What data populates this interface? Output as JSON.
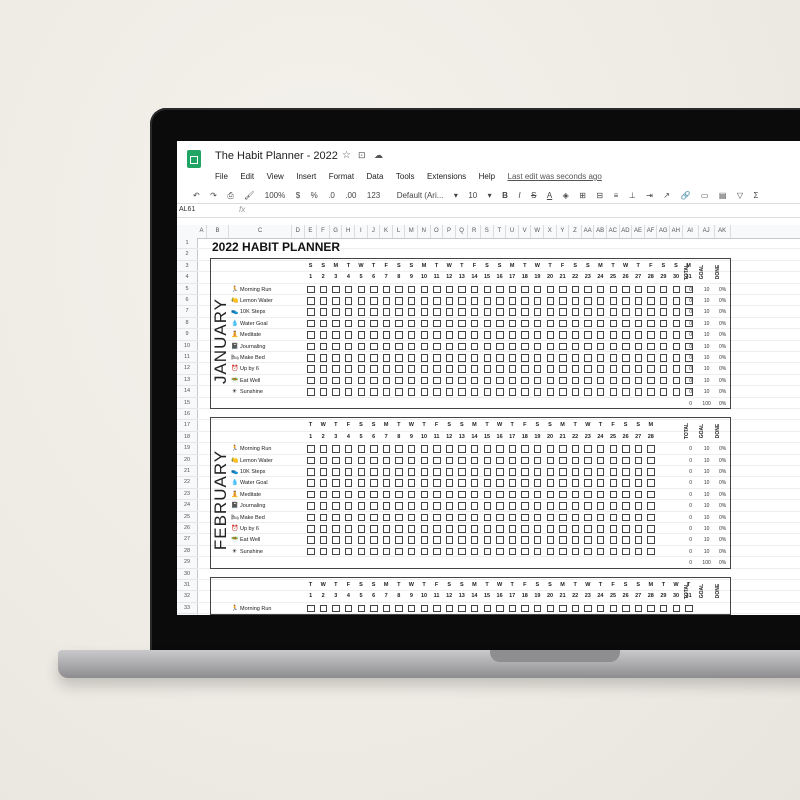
{
  "app": {
    "title": "The Habit Planner - 2022",
    "last_edit": "Last edit was seconds ago",
    "menu": [
      "File",
      "Edit",
      "View",
      "Insert",
      "Format",
      "Data",
      "Tools",
      "Extensions",
      "Help"
    ]
  },
  "toolbar": {
    "zoom": "100%",
    "currency": "$",
    "percent": "%",
    "dec_less": ".0",
    "dec_more": ".00",
    "format": "123",
    "font": "Default (Ari...",
    "font_size": "10",
    "bold": "B",
    "italic": "I",
    "strike": "S",
    "text_color": "A"
  },
  "formula_bar": {
    "cell_ref": "AL61",
    "fx": "fx"
  },
  "sheet": {
    "title": "2022 HABIT PLANNER",
    "col_headers": [
      "A",
      "B",
      "C",
      "D",
      "E",
      "F",
      "G",
      "H",
      "I",
      "J",
      "K",
      "L",
      "M",
      "N",
      "O",
      "P",
      "Q",
      "R",
      "S",
      "T",
      "U",
      "V",
      "W",
      "X",
      "Y",
      "Z",
      "AA",
      "AB",
      "AC",
      "AD",
      "AE",
      "AF",
      "AG",
      "AH",
      "AI",
      "AJ",
      "AK"
    ],
    "row_numbers": [
      "1",
      "2",
      "3",
      "4",
      "5",
      "6",
      "7",
      "8",
      "9",
      "10",
      "11",
      "12",
      "13",
      "14",
      "15",
      "16",
      "17",
      "18",
      "19",
      "20",
      "21",
      "22",
      "23",
      "24",
      "25",
      "26",
      "27",
      "28",
      "29",
      "30",
      "31",
      "32",
      "33"
    ],
    "summary_headers": [
      "TOTAL",
      "GOAL",
      "DONE"
    ],
    "habits": [
      {
        "icon": "🏃",
        "name": "Morning Run"
      },
      {
        "icon": "🍋",
        "name": "Lemon Water"
      },
      {
        "icon": "👟",
        "name": "10K Steps"
      },
      {
        "icon": "💧",
        "name": "Water Goal"
      },
      {
        "icon": "🧘",
        "name": "Meditate"
      },
      {
        "icon": "📓",
        "name": "Journaling"
      },
      {
        "icon": "🛏",
        "name": "Make Bed"
      },
      {
        "icon": "⏰",
        "name": "Up by 6"
      },
      {
        "icon": "🥗",
        "name": "Eat Well"
      },
      {
        "icon": "☀",
        "name": "Sunshine"
      }
    ],
    "months": [
      {
        "name": "JANUARY",
        "weekdays": [
          "S",
          "S",
          "M",
          "T",
          "W",
          "T",
          "F",
          "S",
          "S",
          "M",
          "T",
          "W",
          "T",
          "F",
          "S",
          "S",
          "M",
          "T",
          "W",
          "T",
          "F",
          "S",
          "S",
          "M",
          "T",
          "W",
          "T",
          "F",
          "S",
          "S",
          "M"
        ],
        "days": [
          "1",
          "2",
          "3",
          "4",
          "5",
          "6",
          "7",
          "8",
          "9",
          "10",
          "11",
          "12",
          "13",
          "14",
          "15",
          "16",
          "17",
          "18",
          "19",
          "20",
          "21",
          "22",
          "23",
          "24",
          "25",
          "26",
          "27",
          "28",
          "29",
          "30",
          "31"
        ],
        "totals": [
          "0",
          "0",
          "0",
          "0",
          "0",
          "0",
          "0",
          "0",
          "0",
          "0"
        ],
        "goals": [
          "10",
          "10",
          "10",
          "10",
          "10",
          "10",
          "10",
          "10",
          "10",
          "10"
        ],
        "done": [
          "0%",
          "0%",
          "0%",
          "0%",
          "0%",
          "0%",
          "0%",
          "0%",
          "0%",
          "0%"
        ],
        "sum": {
          "total": "0",
          "goal": "100",
          "done": "0%"
        }
      },
      {
        "name": "FEBRUARY",
        "weekdays": [
          "T",
          "W",
          "T",
          "F",
          "S",
          "S",
          "M",
          "T",
          "W",
          "T",
          "F",
          "S",
          "S",
          "M",
          "T",
          "W",
          "T",
          "F",
          "S",
          "S",
          "M",
          "T",
          "W",
          "T",
          "F",
          "S",
          "S",
          "M"
        ],
        "days": [
          "1",
          "2",
          "3",
          "4",
          "5",
          "6",
          "7",
          "8",
          "9",
          "10",
          "11",
          "12",
          "13",
          "14",
          "15",
          "16",
          "17",
          "18",
          "19",
          "20",
          "21",
          "22",
          "23",
          "24",
          "25",
          "26",
          "27",
          "28"
        ],
        "totals": [
          "0",
          "0",
          "0",
          "0",
          "0",
          "0",
          "0",
          "0",
          "0",
          "0"
        ],
        "goals": [
          "10",
          "10",
          "10",
          "10",
          "10",
          "10",
          "10",
          "10",
          "10",
          "10"
        ],
        "done": [
          "0%",
          "0%",
          "0%",
          "0%",
          "0%",
          "0%",
          "0%",
          "0%",
          "0%",
          "0%"
        ],
        "sum": {
          "total": "0",
          "goal": "100",
          "done": "0%"
        }
      },
      {
        "name": "",
        "weekdays": [
          "T",
          "W",
          "T",
          "F",
          "S",
          "S",
          "M",
          "T",
          "W",
          "T",
          "F",
          "S",
          "S",
          "M",
          "T",
          "W",
          "T",
          "F",
          "S",
          "S",
          "M",
          "T",
          "W",
          "T",
          "F",
          "S",
          "S",
          "M",
          "T",
          "W",
          "T"
        ],
        "days": [
          "1",
          "2",
          "3",
          "4",
          "5",
          "6",
          "7",
          "8",
          "9",
          "10",
          "11",
          "12",
          "13",
          "14",
          "15",
          "16",
          "17",
          "18",
          "19",
          "20",
          "21",
          "22",
          "23",
          "24",
          "25",
          "26",
          "27",
          "28",
          "29",
          "30",
          "31"
        ],
        "first_habit": {
          "icon": "🏃",
          "name": "Morning Run"
        }
      }
    ]
  }
}
